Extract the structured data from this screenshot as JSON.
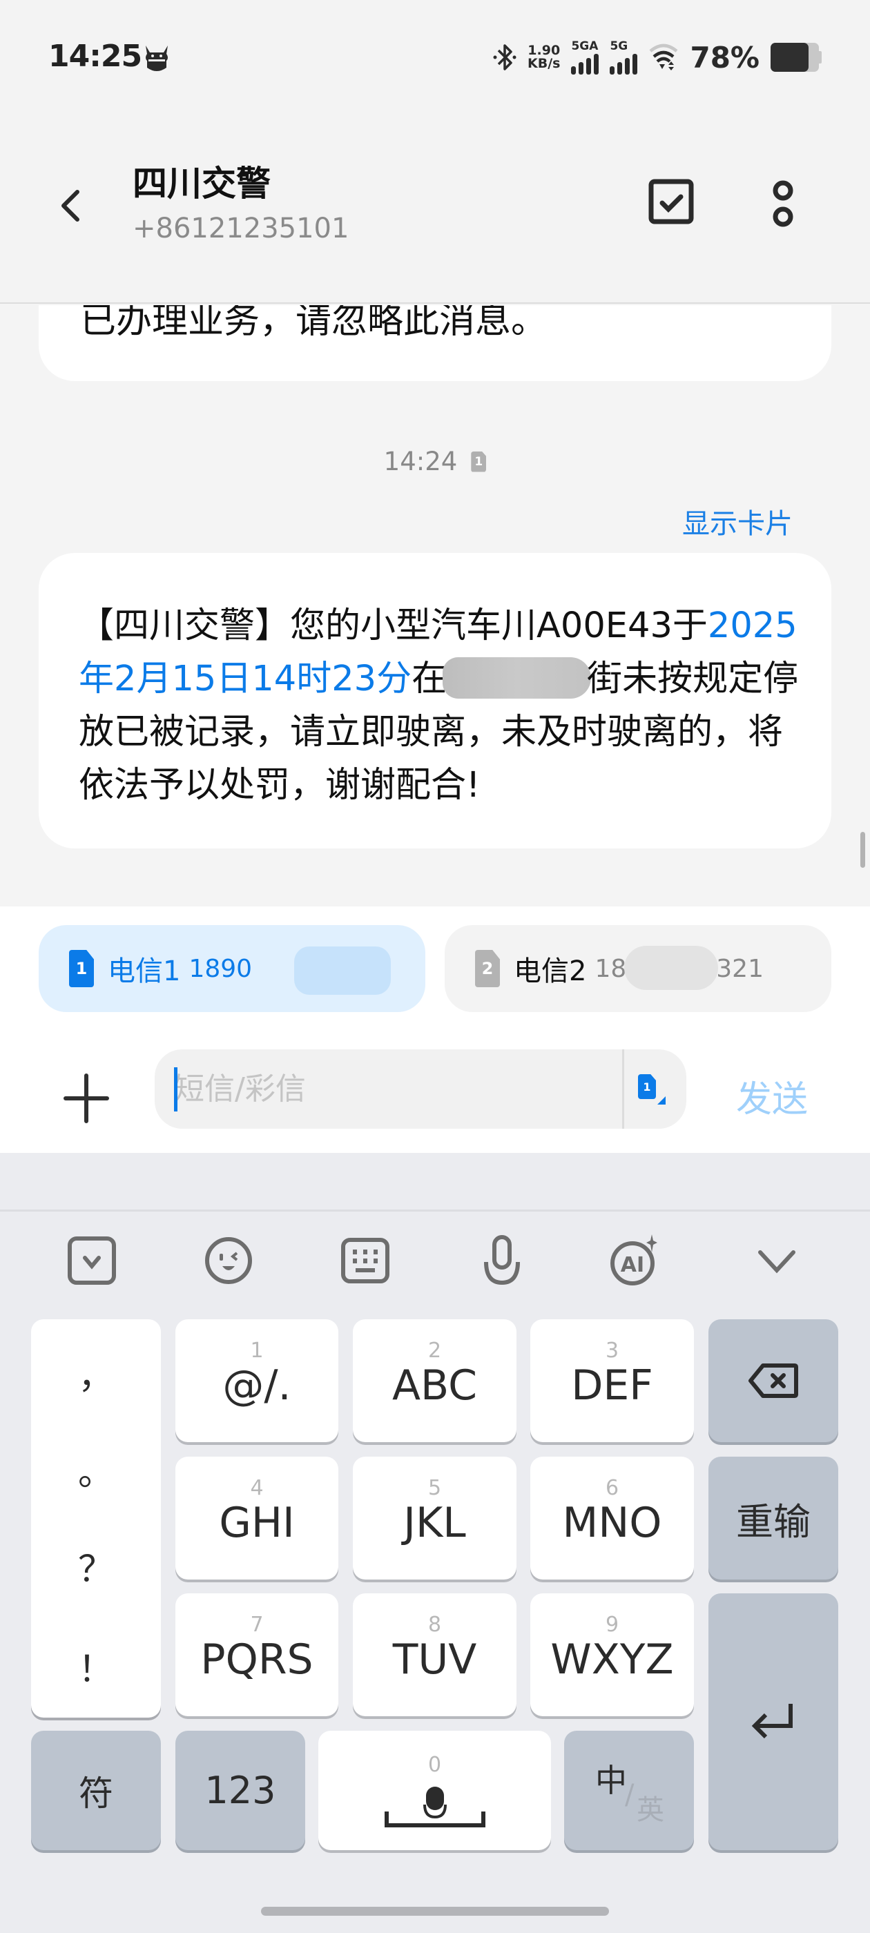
{
  "status_bar": {
    "time": "14:25",
    "net_speed_value": "1.90",
    "net_speed_unit": "KB/s",
    "sim1_network": "5GA",
    "sim2_network": "5G",
    "battery_percent": "78%",
    "battery_level": 0.78,
    "icons": [
      "mascot-icon",
      "bluetooth-icon",
      "signal-icon",
      "signal-icon",
      "wifi-icon",
      "battery-icon"
    ]
  },
  "header": {
    "contact_name": "四川交警",
    "contact_number": "+86121235101",
    "back_icon": "chevron-left-icon",
    "select_icon": "checkbox-icon",
    "more_icon": "more-vertical-icon"
  },
  "conversation": {
    "previous_message_tail": "已办理业务，请忽略此消息。",
    "timestamp": "14:24",
    "timestamp_sim": "1",
    "show_card_label": "显示卡片",
    "message": {
      "part1": "【四川交警】您的小型汽车川A00E43于",
      "date_link": "2025年2月15日14时23分",
      "part2": "在",
      "part3": "街未按规定停放已被记录，请立即驶离，未及时驶离的，将依法予以处罚，谢谢配合!"
    }
  },
  "compose": {
    "sim_options": [
      {
        "slot": "1",
        "label": "电信1",
        "number_visible": "1890",
        "selected": true
      },
      {
        "slot": "2",
        "label": "电信2",
        "number_visible_start": "18",
        "number_visible_end": "321",
        "selected": false
      }
    ],
    "input_placeholder": "短信/彩信",
    "input_value": "",
    "input_sim_slot": "1",
    "send_label": "发送",
    "add_icon": "plus-icon"
  },
  "keyboard": {
    "toolbar_icons": [
      "keyboard-collapse-icon",
      "emoji-icon",
      "keyboard-layout-icon",
      "microphone-icon",
      "ai-icon",
      "chevron-down-icon"
    ],
    "ai_label": "AI",
    "punctuation": [
      "，",
      "。",
      "？",
      "！"
    ],
    "keys": [
      {
        "num": "1",
        "main": "@/."
      },
      {
        "num": "2",
        "main": "ABC"
      },
      {
        "num": "3",
        "main": "DEF"
      },
      {
        "num": "4",
        "main": "GHI"
      },
      {
        "num": "5",
        "main": "JKL"
      },
      {
        "num": "6",
        "main": "MNO"
      },
      {
        "num": "7",
        "main": "PQRS"
      },
      {
        "num": "8",
        "main": "TUV"
      },
      {
        "num": "9",
        "main": "WXYZ"
      }
    ],
    "reset_label": "重输",
    "symbols_label": "符",
    "numbers_label": "123",
    "space_num": "0",
    "lang_main": "中",
    "lang_slash": "/",
    "lang_alt": "英"
  }
}
